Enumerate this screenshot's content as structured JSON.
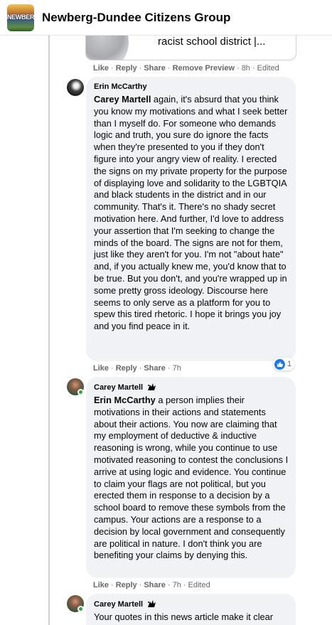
{
  "header": {
    "group_name": "Newberg-Dundee Citizens Group",
    "logo_text": "NEWBERG"
  },
  "link_preview": {
    "title": "racist school district |..."
  },
  "top_actions": {
    "like": "Like",
    "reply": "Reply",
    "share": "Share",
    "remove_preview": "Remove Preview",
    "time": "8h",
    "edited": "Edited"
  },
  "comments": [
    {
      "author": "Erin McCarthy",
      "mention": "Carey Martell",
      "text": " again, it's absurd that you think you know my motivations and what I seek better than I myself do. For someone who demands logic and truth, you sure do ignore the facts when they're presented to you if they don't figure into your angry view of reality. I erected the signs on my private property for the purpose of displaying love and solidarity to the LGBTQIA and black students in the district and in our community. That's it. There's no shady secret motivation here. And further, I'd love to address your assertion that I'm seeking to change the minds of the board. The signs are not for them, just like they aren't for you. I'm not \"about hate\" and, if you actually knew me, you'd know that to be true. But you don't, and you're wrapped up in some pretty gross ideology. Discourse here seems to only serve as a platform for you to spew this tired rhetoric. I hope it brings you joy and you find peace in it.",
      "actions": {
        "like": "Like",
        "reply": "Reply",
        "share": "Share",
        "time": "7h",
        "edited": ""
      },
      "reactions": {
        "icon": "like-icon",
        "count": "1"
      }
    },
    {
      "author": "Carey Martell",
      "mention": "Erin McCarthy",
      "text": " a person implies their motivations in their actions and statements about their actions. You now are claiming that my employment of deductive & inductive reasoning is wrong, while you continue to use motivated reasoning to contest the conclusions I arrive at using logic and evidence. You continue to claim your flags are not political, but you erected them in response to a decision by a school board to remove these symbols from the campus. Your actions are a response to a decision by local government and consequently are political in nature. I don't think you are benefiting your claims by denying this.",
      "actions": {
        "like": "Like",
        "reply": "Reply",
        "share": "Share",
        "time": "7h",
        "edited": "Edited"
      }
    },
    {
      "author": "Carey Martell",
      "mention": "",
      "text": "Your quotes in this news article make it clear"
    }
  ],
  "colors": {
    "bubble": "#f0f2f5",
    "meta_text": "#65676b",
    "like_blue": "#1877f2",
    "online_green": "#31a24c"
  }
}
